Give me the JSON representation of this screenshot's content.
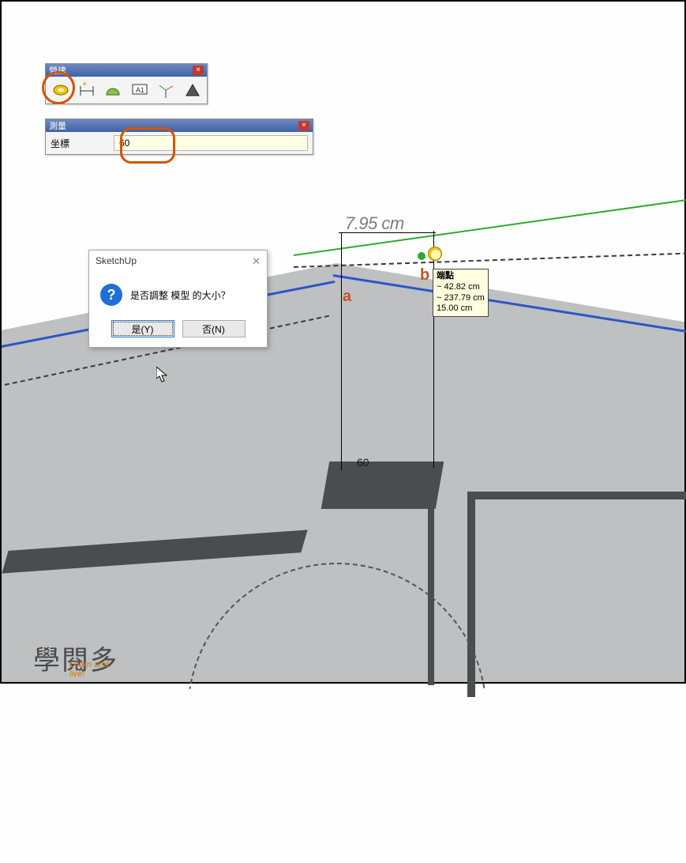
{
  "toolbar": {
    "title": "營建",
    "icons": [
      "tape-measure-icon",
      "dimension-icon",
      "protractor-icon",
      "text-label-icon",
      "axes-icon",
      "section-plane-icon"
    ]
  },
  "measure_panel": {
    "title": "測量",
    "label": "坐標",
    "value": "60"
  },
  "dimension": {
    "text": "7.95 cm",
    "floor_dim": "60"
  },
  "markers": {
    "a": "a",
    "b": "b"
  },
  "tooltip": {
    "title": "端點",
    "line1": "~ 42.82 cm",
    "line2": "~ 237.79 cm",
    "line3": "15.00 cm"
  },
  "dialog": {
    "title": "SketchUp",
    "message": "是否調整 模型 的大小？",
    "yes": "是(Y)",
    "no": "否(N)"
  },
  "watermark": {
    "text": "學閱多",
    "sub": "Learn and live!"
  }
}
